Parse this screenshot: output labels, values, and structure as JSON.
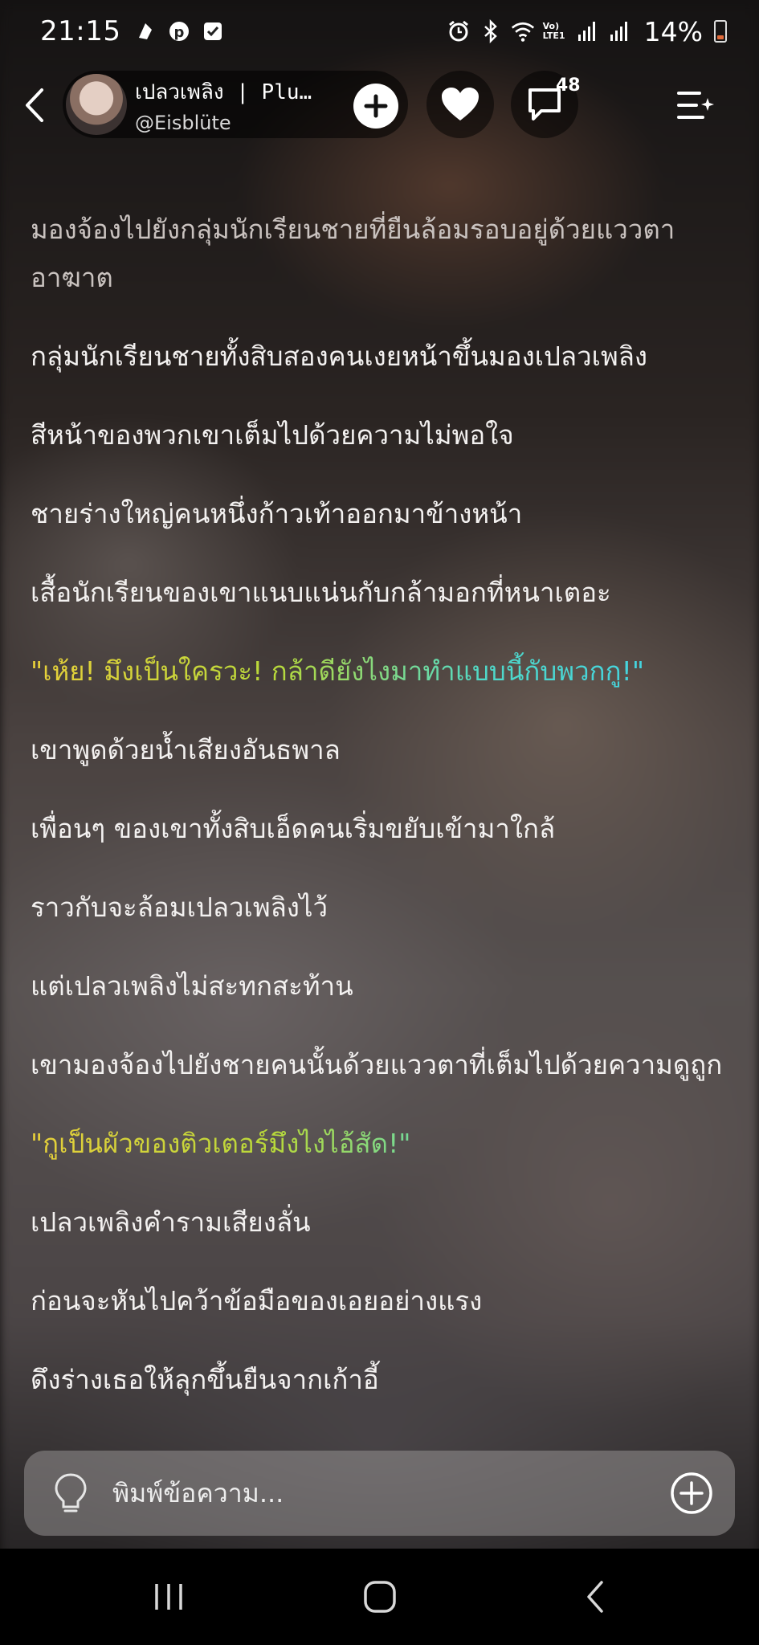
{
  "status_bar": {
    "time": "21:15",
    "battery": "14%",
    "network_label": "Vo) LTE1"
  },
  "header": {
    "character_name": "เปลวเพลิง | Plu…",
    "handle": "@Eisblüte",
    "comment_count": "48"
  },
  "story": {
    "paragraphs": [
      {
        "text": "มองจ้องไปยังกลุ่มนักเรียนชายที่ยืนล้อมรอบอยู่ด้วยแววตาอาฆาต",
        "style": "faded"
      },
      {
        "text": "กลุ่มนักเรียนชายทั้งสิบสองคนเงยหน้าขึ้นมองเปลวเพลิง",
        "style": "normal"
      },
      {
        "text": "สีหน้าของพวกเขาเต็มไปด้วยความไม่พอใจ",
        "style": "normal"
      },
      {
        "text": "ชายร่างใหญ่คนหนึ่งก้าวเท้าออกมาข้างหน้า",
        "style": "normal"
      },
      {
        "text": "เสื้อนักเรียนของเขาแนบแน่นกับกล้ามอกที่หนาเตอะ",
        "style": "normal"
      },
      {
        "text": "\"เห้ย! มึงเป็นใครวะ! กล้าดียังไงมาทำแบบนี้กับพวกกู!\"",
        "style": "quote"
      },
      {
        "text": "เขาพูดด้วยน้ำเสียงอันธพาล",
        "style": "normal"
      },
      {
        "text": "เพื่อนๆ ของเขาทั้งสิบเอ็ดคนเริ่มขยับเข้ามาใกล้",
        "style": "normal"
      },
      {
        "text": "ราวกับจะล้อมเปลวเพลิงไว้",
        "style": "normal"
      },
      {
        "text": "แต่เปลวเพลิงไม่สะทกสะท้าน",
        "style": "normal"
      },
      {
        "text": "เขามองจ้องไปยังชายคนนั้นด้วยแววตาที่เต็มไปด้วยความดูถูก",
        "style": "normal"
      },
      {
        "text": "\"กูเป็นผัวของติวเตอร์มึงไงไอ้สัด!\"",
        "style": "quote"
      },
      {
        "text": "เปลวเพลิงคำรามเสียงลั่น",
        "style": "normal"
      },
      {
        "text": "ก่อนจะหันไปคว้าข้อมือของเอยอย่างแรง",
        "style": "normal"
      },
      {
        "text": "ดึงร่างเธอให้ลุกขึ้นยืนจากเก้าอี้",
        "style": "normal"
      }
    ]
  },
  "input": {
    "placeholder": "พิมพ์ข้อความ..."
  },
  "colors": {
    "quote_gradient_start": "#e7cf3a",
    "quote_gradient_end": "#3fd0ea",
    "input_bar": "#8f8a8a",
    "battery_low": "#e06a3a"
  },
  "icons": [
    "back-icon",
    "add-icon",
    "heart-icon",
    "comment-icon",
    "menu-sparkle-icon",
    "lightbulb-icon",
    "plus-circle-icon",
    "recents-icon",
    "home-icon",
    "nav-back-icon"
  ]
}
